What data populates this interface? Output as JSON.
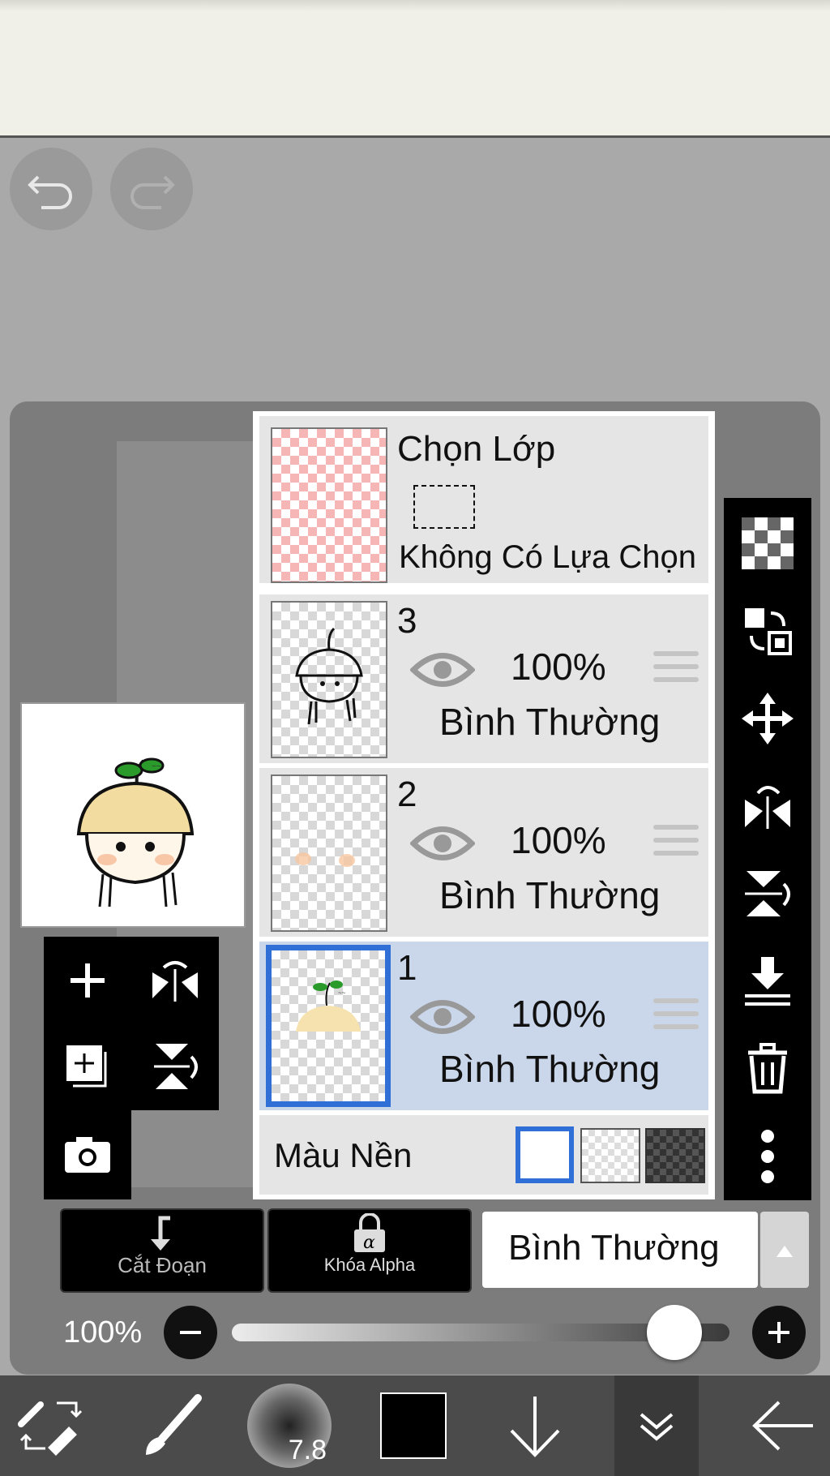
{
  "layers_panel": {
    "selection_layer": {
      "title": "Chọn Lớp",
      "subtitle": "Không Có Lựa Chọn"
    },
    "layers": [
      {
        "name": "3",
        "opacity": "100%",
        "blend": "Bình Thường",
        "visible": true,
        "selected": false
      },
      {
        "name": "2",
        "opacity": "100%",
        "blend": "Bình Thường",
        "visible": true,
        "selected": false
      },
      {
        "name": "1",
        "opacity": "100%",
        "blend": "Bình Thường",
        "visible": true,
        "selected": true
      }
    ],
    "background": {
      "label": "Màu Nền",
      "options": [
        "white",
        "checker-light",
        "checker-dark"
      ],
      "selected": "white"
    }
  },
  "bottom_controls": {
    "clipping_label": "Cắt Đoạn",
    "alpha_lock_label": "Khóa Alpha",
    "blend_mode": "Bình Thường",
    "opacity_value": "100%",
    "opacity_fraction": 1.0
  },
  "toolbar": {
    "brush_size": "7.8",
    "color": "#000000"
  },
  "colors": {
    "selection_blue": "#2f6fd6",
    "selected_layer_bg": "#cad6ea"
  }
}
